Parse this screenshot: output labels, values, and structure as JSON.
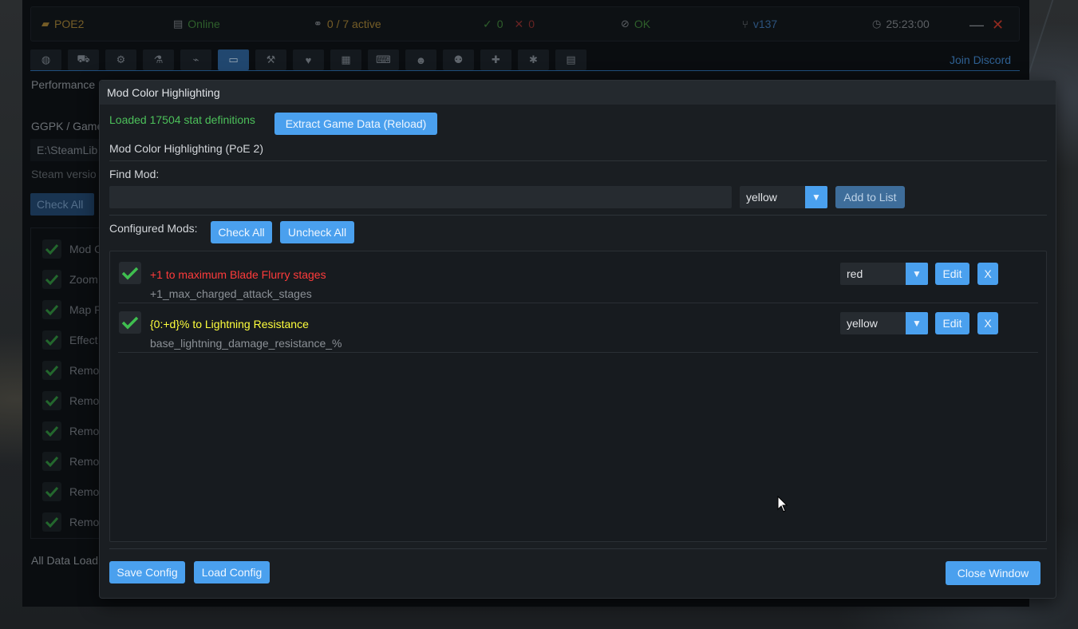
{
  "status": {
    "game": "POE2",
    "connection": "Online",
    "active": "0 / 7 active",
    "ok_count": "0",
    "err_count": "0",
    "state": "OK",
    "version": "v137",
    "timer": "25:23:00",
    "minimize": "—",
    "close": "✕"
  },
  "tabs": [
    {
      "icon": "globe-icon",
      "glyph": "◍"
    },
    {
      "icon": "cart-icon",
      "glyph": "⛟"
    },
    {
      "icon": "gear-icon",
      "glyph": "⚙"
    },
    {
      "icon": "flask-icon",
      "glyph": "⚗"
    },
    {
      "icon": "satellite-icon",
      "glyph": "⌁"
    },
    {
      "icon": "monitor-icon",
      "glyph": "▭"
    },
    {
      "icon": "hammer-icon",
      "glyph": "⚒"
    },
    {
      "icon": "heartbeat-icon",
      "glyph": "♥"
    },
    {
      "icon": "map-icon",
      "glyph": "▦"
    },
    {
      "icon": "keyboard-icon",
      "glyph": "⌨"
    },
    {
      "icon": "user-icon",
      "glyph": "☻"
    },
    {
      "icon": "robot-icon",
      "glyph": "⚉"
    },
    {
      "icon": "puzzle-icon",
      "glyph": "✚"
    },
    {
      "icon": "bug-icon",
      "glyph": "✱"
    },
    {
      "icon": "file-icon",
      "glyph": "▤"
    }
  ],
  "join_discord": "Join Discord",
  "background": {
    "performance": "Performance",
    "ggpk_label": "GGPK / Game",
    "path": "E:\\SteamLib",
    "steam_version": "Steam versio",
    "check_all": "Check All",
    "rows": [
      "Mod C",
      "Zoom",
      "Map R",
      "Effect",
      "Remo",
      "Remo",
      "Remo",
      "Remo",
      "Remo",
      "Remo"
    ],
    "status": "All Data Load"
  },
  "modal": {
    "title": "Mod Color Highlighting",
    "loaded": "Loaded 17504 stat definitions",
    "extract_btn": "Extract Game Data (Reload)",
    "section_title": "Mod Color Highlighting (PoE 2)",
    "find_label": "Find Mod:",
    "find_value": "",
    "find_color": "yellow",
    "add_btn": "Add to List",
    "configured_label": "Configured Mods:",
    "check_all": "Check All",
    "uncheck_all": "Uncheck All",
    "mods": [
      {
        "name": "+1 to maximum Blade Flurry stages",
        "id": "+1_max_charged_attack_stages",
        "color": "red",
        "name_color": "#ff3b3b",
        "checked": true
      },
      {
        "name": "{0:+d}% to Lightning Resistance",
        "id": "base_lightning_damage_resistance_%",
        "color": "yellow",
        "name_color": "#ffff3c",
        "checked": true
      }
    ],
    "edit_label": "Edit",
    "remove_label": "X",
    "save_btn": "Save Config",
    "load_btn": "Load Config",
    "close_btn": "Close Window"
  },
  "colors": {
    "accent": "#4aa0ee",
    "success": "#4cc05a",
    "check": "#3fbf4f"
  }
}
